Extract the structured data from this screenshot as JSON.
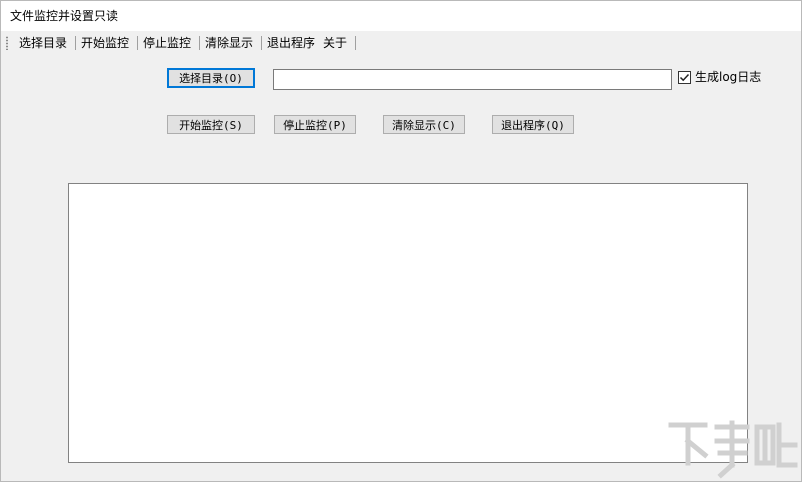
{
  "window": {
    "title": "文件监控并设置只读"
  },
  "menu": {
    "items": [
      "选择目录",
      "开始监控",
      "停止监控",
      "清除显示",
      "退出程序",
      "关于"
    ]
  },
  "form": {
    "select_dir_button": "选择目录(O)",
    "path_value": "",
    "path_placeholder": "",
    "log_checkbox_label": "生成log日志",
    "log_checkbox_checked": true
  },
  "actions": {
    "start_button": "开始监控(S)",
    "stop_button": "停止监控(P)",
    "clear_button": "清除显示(C)",
    "exit_button": "退出程序(Q)"
  },
  "log": {
    "lines": []
  },
  "colors": {
    "window_bg": "#f0f0f0",
    "button_bg": "#e1e1e1",
    "focus_border": "#0078d7",
    "watermark": "#d0d0d0"
  },
  "watermark_icon": "watermark-logo-icon"
}
